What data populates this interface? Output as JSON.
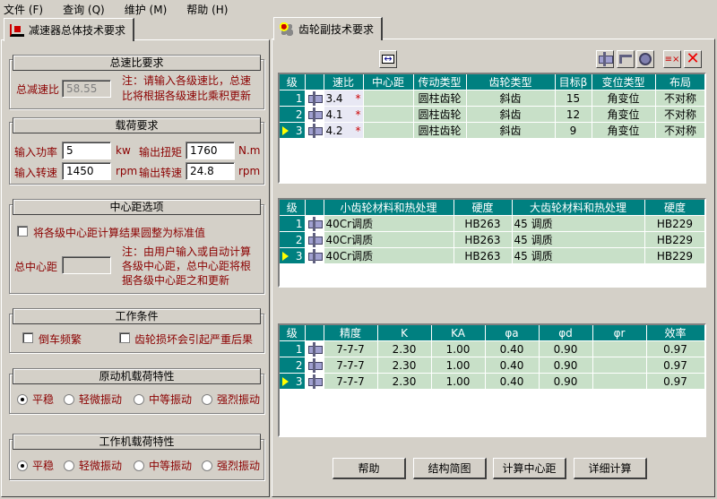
{
  "menu": [
    "文件 (F)",
    "查询 (Q)",
    "维护 (M)",
    "帮助 (H)"
  ],
  "tabs": {
    "left": "减速器总体技术要求",
    "right": "齿轮副技术要求"
  },
  "ratio": {
    "title": "总速比要求",
    "label": "总减速比",
    "value": "58.55",
    "note1": "注：请输入各级速比，总速",
    "note2": "比将根据各级速比乘积更新"
  },
  "load": {
    "title": "载荷要求",
    "in_power_label": "输入功率",
    "in_power": "5",
    "in_power_unit": "kw",
    "out_torque_label": "输出扭矩",
    "out_torque": "1760",
    "out_torque_unit": "N.m",
    "in_speed_label": "输入转速",
    "in_speed": "1450",
    "in_speed_unit": "rpm",
    "out_speed_label": "输出转速",
    "out_speed": "24.8",
    "out_speed_unit": "rpm"
  },
  "center": {
    "title": "中心距选项",
    "round_label": "将各级中心距计算结果圆整为标准值",
    "round_checked": false,
    "total_label": "总中心距",
    "total_value": "",
    "note1": "注：由用户输入或自动计算",
    "note2": "各级中心距，总中心距将根",
    "note3": "据各级中心距之和更新"
  },
  "work": {
    "title": "工作条件",
    "reverse_label": "倒车频繁",
    "reverse_checked": false,
    "damage_label": "齿轮损坏会引起严重后果",
    "damage_checked": false
  },
  "prime": {
    "title": "原动机载荷特性",
    "options": [
      "平稳",
      "轻微振动",
      "中等振动",
      "强烈振动"
    ],
    "selected": 0
  },
  "driven": {
    "title": "工作机载荷特性",
    "options": [
      "平稳",
      "轻微振动",
      "中等振动",
      "强烈振动"
    ],
    "selected": 0
  },
  "grid1": {
    "headers": [
      "级",
      "",
      "速比",
      "中心距",
      "传动类型",
      "齿轮类型",
      "目标β",
      "变位类型",
      "布局"
    ],
    "rows": [
      [
        "1",
        "",
        "3.4",
        "",
        "圆柱齿轮",
        "斜齿",
        "15",
        "角变位",
        "不对称"
      ],
      [
        "2",
        "",
        "4.1",
        "",
        "圆柱齿轮",
        "斜齿",
        "12",
        "角变位",
        "不对称"
      ],
      [
        "3",
        "",
        "4.2",
        "",
        "圆柱齿轮",
        "斜齿",
        "9",
        "角变位",
        "不对称"
      ]
    ],
    "required_mark": "*",
    "current_row": 2
  },
  "grid2": {
    "headers": [
      "级",
      "",
      "小齿轮材料和热处理",
      "硬度",
      "大齿轮材料和热处理",
      "硬度"
    ],
    "rows": [
      [
        "1",
        "",
        "40Cr调质",
        "HB263",
        "45 调质",
        "HB229"
      ],
      [
        "2",
        "",
        "40Cr调质",
        "HB263",
        "45 调质",
        "HB229"
      ],
      [
        "3",
        "",
        "40Cr调质",
        "HB263",
        "45 调质",
        "HB229"
      ]
    ],
    "current_row": 2
  },
  "grid3": {
    "headers": [
      "级",
      "",
      "精度",
      "K",
      "KA",
      "φa",
      "φd",
      "φr",
      "效率"
    ],
    "rows": [
      [
        "1",
        "",
        "7-7-7",
        "2.30",
        "1.00",
        "0.40",
        "0.90",
        "",
        "0.97"
      ],
      [
        "2",
        "",
        "7-7-7",
        "2.30",
        "1.00",
        "0.40",
        "0.90",
        "",
        "0.97"
      ],
      [
        "3",
        "",
        "7-7-7",
        "2.30",
        "1.00",
        "0.40",
        "0.90",
        "",
        "0.97"
      ]
    ],
    "current_row": 2
  },
  "buttons": {
    "help": "帮助",
    "structure": "结构简图",
    "calc_center": "计算中心距",
    "detail": "详细计算"
  },
  "colors": {
    "header": "#008080",
    "cell": "#c8e0c8",
    "note": "#8b0000"
  }
}
